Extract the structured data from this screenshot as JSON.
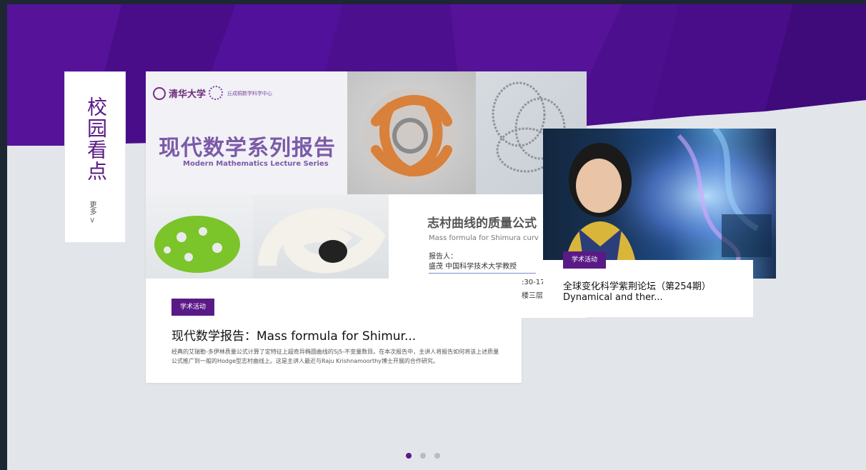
{
  "sidebar": {
    "title": "校园看点",
    "more": "更多 >"
  },
  "main_card": {
    "poster": {
      "logo_tsinghua": "清华大学",
      "logo_center": "丘成桐数学科学中心",
      "title_cn": "现代数学系列报告",
      "title_en": "Modern Mathematics Lecture Series",
      "talk_title_cn": "志村曲线的质量公式",
      "talk_title_en": "Mass formula for Shimura curv",
      "reporter_label": "报告人：",
      "reporter": "盛茂   中国科学技术大学教授",
      "time_partial": ":30-17",
      "place_partial": "楼三层"
    },
    "tag": "学术活动",
    "title": "现代数学报告：Mass formula for Shimur...",
    "description": "经典的艾瑞勒-多伊林质量公式计算了定特征上超奇异椭圆曲线的Sj5-不变量数目。在本次报告中，主讲人将报告如何将该上述质量公式推广到一般的Hodge型志村曲线上。这是主讲人最近与Raju Krishnamoorthy博士开展的合作研究。"
  },
  "side_card": {
    "tag": "学术活动",
    "title_line1": "全球变化科学紫荆论坛（第254期）",
    "title_line2": "Dynamical and ther..."
  },
  "carousel": {
    "count": 3,
    "active": 0
  },
  "colors": {
    "brand": "#5a1a86",
    "band": "#4a0e8c",
    "band_dark": "#3a0a72",
    "bg": "#e2e5e9"
  }
}
